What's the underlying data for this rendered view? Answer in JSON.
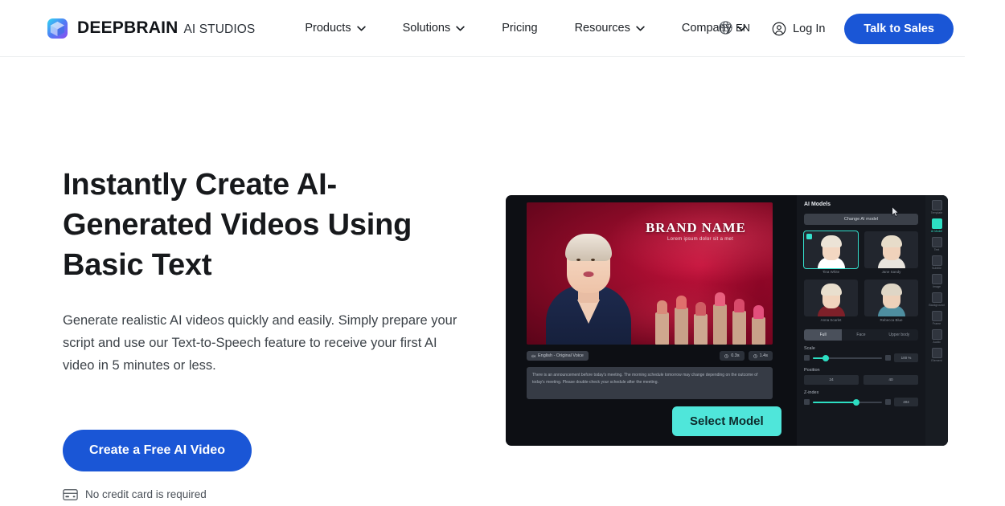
{
  "header": {
    "logo_icon": "deepbrain-cube-logo",
    "brand_name": "DEEPBRAIN",
    "brand_sub": "AI STUDIOS",
    "nav": [
      {
        "label": "Products",
        "has_caret": true,
        "icon": "chevron-down-icon"
      },
      {
        "label": "Solutions",
        "has_caret": true,
        "icon": "chevron-down-icon"
      },
      {
        "label": "Pricing",
        "has_caret": false,
        "icon": ""
      },
      {
        "label": "Resources",
        "has_caret": true,
        "icon": "chevron-down-icon"
      },
      {
        "label": "Company",
        "has_caret": true,
        "icon": "chevron-down-icon"
      }
    ],
    "language": {
      "label": "EN",
      "icon": "globe-icon"
    },
    "login": {
      "label": "Log In",
      "icon": "user-circle-icon"
    },
    "sales_button": {
      "label": "Talk to Sales",
      "color": "#1a56d6"
    }
  },
  "hero": {
    "headline": "Instantly Create AI-Generated Videos Using Basic Text",
    "subtitle": "Generate realistic AI videos quickly and easily. Simply prepare your script and use our Text-to-Speech feature to receive your first AI video in 5 minutes or less.",
    "cta_label": "Create a Free AI Video",
    "cta_color": "#1a56d6",
    "note": "No credit card is required",
    "note_icon": "credit-card-icon"
  },
  "mockup": {
    "video": {
      "brand_title": "BRAND NAME",
      "brand_tagline": "Lorem ipsum dolor sit a met",
      "avatar_alt": "ai-presenter-avatar"
    },
    "toolbar": {
      "voice_chip": "English - Original Voice",
      "voice_icon": "sound-wave-icon",
      "duration_chip": "0.3s",
      "duration_icon": "clock-icon",
      "total_chip": "1.4s",
      "total_icon": "clock-icon"
    },
    "script_text": "There is an announcement before today's meeting. The morning schedule tomorrow may change depending on the outcome of today's meeting. Please double-check your schedule after the meeting.",
    "panel": {
      "title": "AI Models",
      "change_button": "Change AI model",
      "models": [
        {
          "name": "Tina White",
          "selected": true,
          "hair": "#ece3d6",
          "skin": "#f3d7c2",
          "body": "#ffffff"
        },
        {
          "name": "Jane Sandy",
          "selected": false,
          "hair": "#e7dcc9",
          "skin": "#f0d2bb",
          "body": "#e8e4dd"
        },
        {
          "name": "Anna Scarlet",
          "selected": false,
          "hair": "#e9dfce",
          "skin": "#f1d4bd",
          "body": "#7e2029"
        },
        {
          "name": "Rebecca Blue",
          "selected": false,
          "hair": "#dfd6c6",
          "skin": "#eed1ba",
          "body": "#4e8ea0"
        }
      ],
      "size_tabs": [
        {
          "label": "Full",
          "active": true
        },
        {
          "label": "Face",
          "active": false
        },
        {
          "label": "Upper body",
          "active": false
        }
      ],
      "scale": {
        "label": "Scale",
        "value": "100 %",
        "percent": 18
      },
      "position": {
        "label": "Position",
        "x_label": "X",
        "x_value": "24",
        "y_label": "Y",
        "y_value": "40"
      },
      "zindex": {
        "label": "Z-index",
        "value": "404",
        "percent": 62
      }
    },
    "rail": [
      {
        "label": "Template",
        "icon": "template-icon",
        "active": false
      },
      {
        "label": "AI Model",
        "icon": "ai-model-icon",
        "active": true
      },
      {
        "label": "Text",
        "icon": "text-icon",
        "active": false
      },
      {
        "label": "Subtitle",
        "icon": "subtitle-icon",
        "active": false
      },
      {
        "label": "Image",
        "icon": "image-icon",
        "active": false
      },
      {
        "label": "Background",
        "icon": "background-icon",
        "active": false
      },
      {
        "label": "Frame",
        "icon": "frame-icon",
        "active": false
      },
      {
        "label": "Audio",
        "icon": "audio-icon",
        "active": false
      },
      {
        "label": "Element",
        "icon": "element-icon",
        "active": false
      }
    ],
    "select_model_button": {
      "label": "Select Model",
      "color": "#4fe6da"
    },
    "cursor_icon": "mouse-cursor-icon"
  }
}
